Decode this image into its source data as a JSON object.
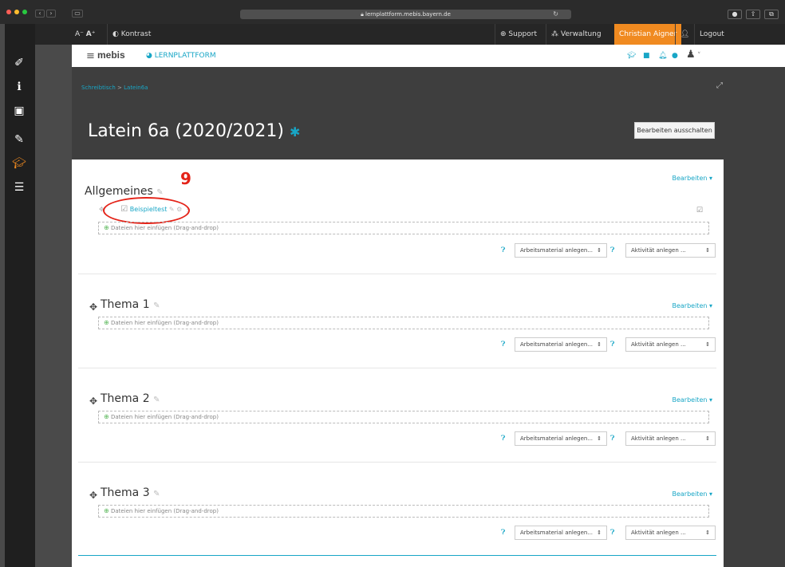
{
  "browser": {
    "url": "lernplattform.mebis.bayern.de",
    "dots": [
      "#ff5f57",
      "#febc2e",
      "#28c840"
    ]
  },
  "topbar": {
    "font_small": "A",
    "font_large": "A",
    "contrast": "Kontrast",
    "support": "Support",
    "verwaltung": "Verwaltung",
    "user": "Christian Aigner",
    "logout": "Logout"
  },
  "header": {
    "logo": "mebis",
    "product": "LERNPLATTFORM"
  },
  "breadcrumb": {
    "home": "Schreibtisch",
    "sep": ">",
    "course": "Latein6a"
  },
  "course": {
    "title": "Latein 6a (2020/2021)",
    "edit_off": "Bearbeiten ausschalten"
  },
  "common": {
    "bearbeiten": "Bearbeiten",
    "dropzone": "Dateien hier einfügen (Drag-and-drop)",
    "add_material": "Arbeitsmaterial anlegen...",
    "add_activity": "Aktivität anlegen ..."
  },
  "sections": [
    {
      "title": "Allgemeines"
    },
    {
      "title": "Thema 1"
    },
    {
      "title": "Thema 2"
    },
    {
      "title": "Thema 3"
    }
  ],
  "activity": {
    "name": "Beispieltest"
  },
  "annotation": {
    "number": "9"
  },
  "colors": {
    "accent": "#18a6c6",
    "user_orange": "#f08a20",
    "annotation_red": "#e42318"
  }
}
